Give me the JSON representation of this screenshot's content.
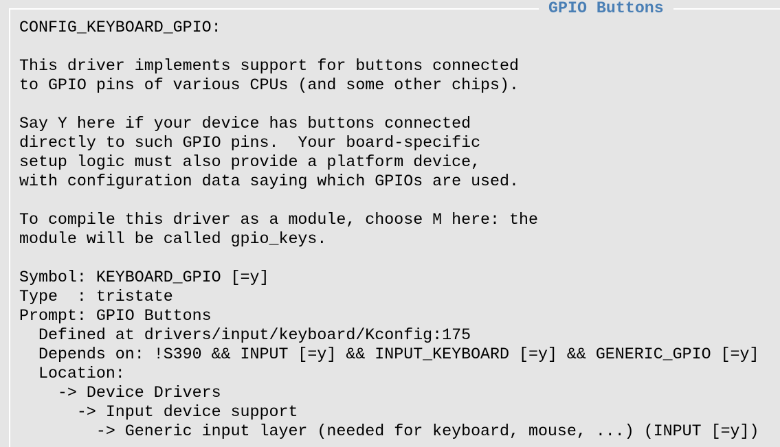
{
  "window": {
    "title": "GPIO Buttons"
  },
  "colors": {
    "background": "#e5e5e5",
    "title": "#4a7fb5",
    "border": "#ffffff",
    "text": "#000000"
  },
  "help": {
    "lines": [
      "CONFIG_KEYBOARD_GPIO:",
      "",
      "This driver implements support for buttons connected",
      "to GPIO pins of various CPUs (and some other chips).",
      "",
      "Say Y here if your device has buttons connected",
      "directly to such GPIO pins.  Your board-specific",
      "setup logic must also provide a platform device,",
      "with configuration data saying which GPIOs are used.",
      "",
      "To compile this driver as a module, choose M here: the",
      "module will be called gpio_keys.",
      "",
      "Symbol: KEYBOARD_GPIO [=y]",
      "Type  : tristate",
      "Prompt: GPIO Buttons",
      "  Defined at drivers/input/keyboard/Kconfig:175",
      "  Depends on: !S390 && INPUT [=y] && INPUT_KEYBOARD [=y] && GENERIC_GPIO [=y]",
      "  Location:",
      "    -> Device Drivers",
      "      -> Input device support",
      "        -> Generic input layer (needed for keyboard, mouse, ...) (INPUT [=y])"
    ]
  }
}
